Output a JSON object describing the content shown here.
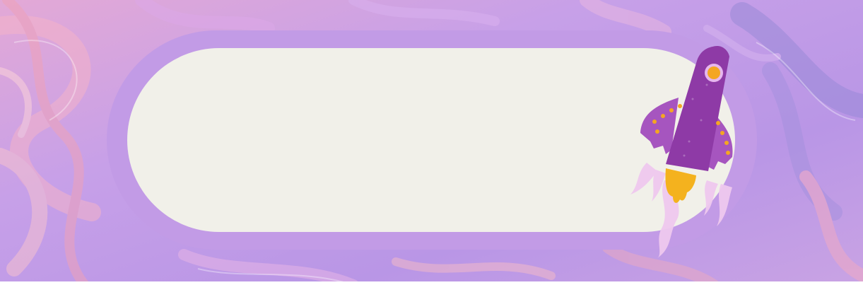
{
  "banner": {
    "text": ""
  },
  "colors": {
    "background": "#c9a6e6",
    "frame": "#c29be6",
    "panel": "#f1f0e9",
    "rocket_body": "#8e3aa6",
    "rocket_wing": "#a655bf",
    "rocket_dots": "#f4a622",
    "flame": "#f4b21e",
    "smoke": "#efc9ef"
  },
  "icons": {
    "rocket": "rocket-icon"
  }
}
